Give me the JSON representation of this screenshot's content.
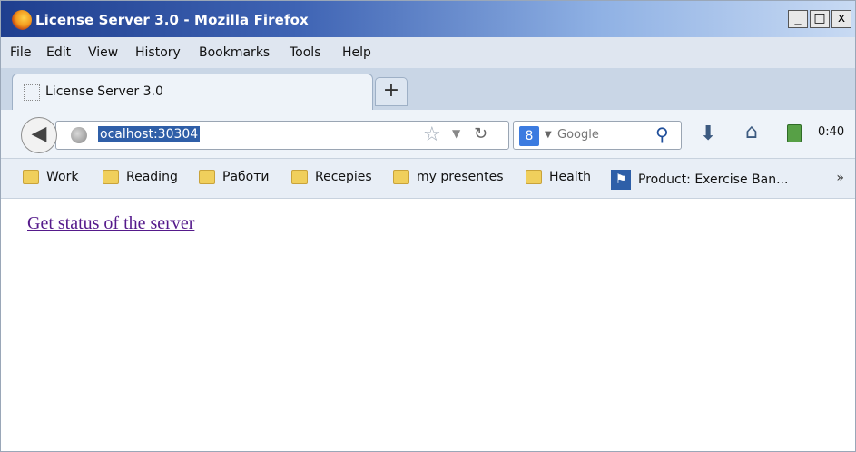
{
  "window": {
    "title": "License Server 3.0 - Mozilla Firefox",
    "controls": [
      "_",
      "□",
      "x"
    ]
  },
  "menu": {
    "items": [
      "File",
      "Edit",
      "View",
      "History",
      "Bookmarks",
      "Tools",
      "Help"
    ]
  },
  "tabs": [
    {
      "label": "License Server 3.0"
    }
  ],
  "newtab_label": "+",
  "navbar": {
    "url": "ocalhost:30304",
    "search_engine": "Google",
    "clock": "0:40"
  },
  "bookmarks": [
    "Work",
    "Reading",
    "Работи",
    "Recepies",
    "my presentes",
    "Health",
    "Product: Exercise Ban..."
  ],
  "bookmarks_more": "»",
  "content": {
    "link_text": "Get status of the server"
  },
  "icons": {
    "back": "back-arrow-icon",
    "site": "globe-icon",
    "bookmark": "star-icon",
    "reload": "reload-icon",
    "search": "magnifier-icon",
    "download": "download-icon",
    "home": "home-icon"
  },
  "colors": {
    "title_bar": "#3f64b4",
    "link_visited": "#551a8b",
    "url_selection": "#2f5fa8"
  }
}
